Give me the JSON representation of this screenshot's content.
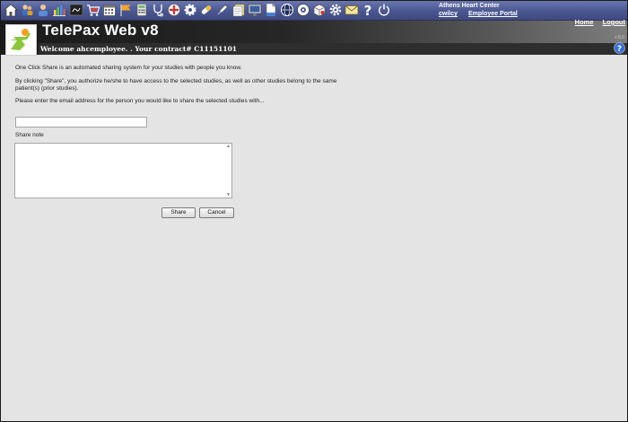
{
  "app": {
    "title": "TelePax Web v8",
    "welcome": "Welcome ahcemployee. . Your contract# C11151101",
    "version": "v 8.0"
  },
  "center": {
    "name": "Athens Heart Center",
    "user_link": "cwilcy",
    "portal_link": "Employee Portal"
  },
  "nav": {
    "home": "Home",
    "logout": "Logout"
  },
  "toolbar_icons": [
    "home-icon",
    "user-group-icon",
    "patient-icon",
    "chart-icon",
    "studies-icon",
    "shopping-cart-icon",
    "calendar-icon",
    "flag-icon",
    "calculator-icon",
    "stethoscope-icon",
    "gear-wheel-icon",
    "pill-icon",
    "syringe-icon",
    "notes-icon",
    "monitor-icon",
    "document-icon",
    "globe-icon",
    "network-icon",
    "package-icon",
    "settings-icon",
    "mail-icon",
    "help-icon",
    "power-icon"
  ],
  "form": {
    "intro": "One Click Share is an automated sharing system for your studies with people you know.",
    "disclaimer": "By clicking \"Share\", you authorize he/she to have access to the selected studies, as well as other studies belong to the same patient(s) (prior studies).",
    "email_prompt": "Please enter the email address for the person you would like to share the selected studies with...",
    "email_value": "",
    "note_label": "Share note",
    "note_value": "",
    "share_button": "Share",
    "cancel_button": "Cancel"
  },
  "colors": {
    "toolbar": "#4a5690",
    "header": "#1b1b1b",
    "background": "#e4e4e4"
  }
}
